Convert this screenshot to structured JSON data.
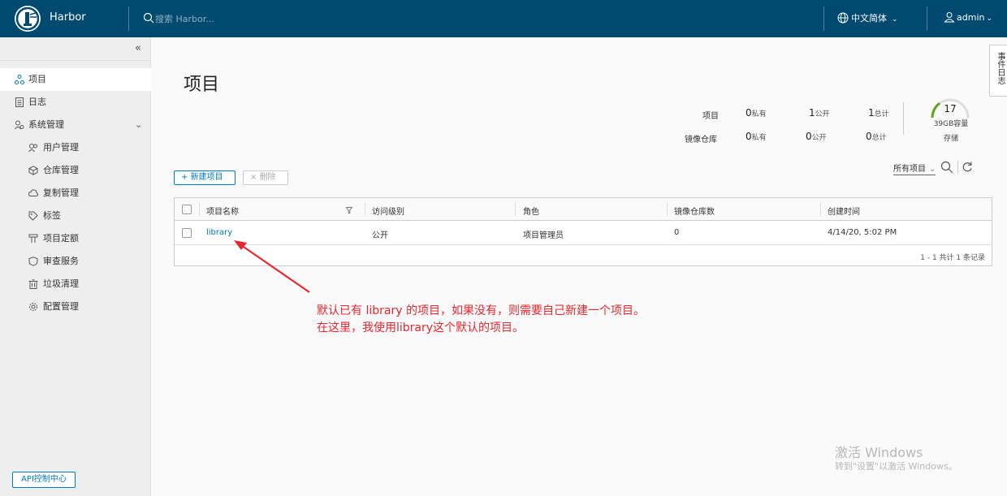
{
  "header": {
    "brand": "Harbor",
    "search_placeholder": "搜索 Harbor...",
    "language": "中文简体",
    "user": "admin"
  },
  "sidebar": {
    "items": [
      {
        "label": "项目",
        "icon": "projects-icon"
      },
      {
        "label": "日志",
        "icon": "logs-icon"
      },
      {
        "label": "系统管理",
        "icon": "admin-icon"
      },
      {
        "label": "用户管理",
        "icon": "users-icon"
      },
      {
        "label": "仓库管理",
        "icon": "registry-icon"
      },
      {
        "label": "复制管理",
        "icon": "replication-icon"
      },
      {
        "label": "标签",
        "icon": "tag-icon"
      },
      {
        "label": "项目定额",
        "icon": "quota-icon"
      },
      {
        "label": "审查服务",
        "icon": "shield-icon"
      },
      {
        "label": "垃圾清理",
        "icon": "trash-icon"
      },
      {
        "label": "配置管理",
        "icon": "gear-icon"
      }
    ],
    "api_button": "API控制中心"
  },
  "main": {
    "title": "项目",
    "stats": {
      "projects_label": "项目",
      "repos_label": "镜像仓库",
      "private_label": "私有",
      "public_label": "公开",
      "total_label": "总计",
      "projects_private": "0",
      "projects_public": "1",
      "projects_total": "1",
      "repos_private": "0",
      "repos_public": "0",
      "repos_total": "0"
    },
    "storage": {
      "count": "17",
      "capacity": "39GB容量",
      "label": "存储",
      "gauge_fraction": 0.3
    },
    "filter": "所有项目",
    "new_button": "+ 新建项目",
    "delete_button": "× 删除",
    "table": {
      "headers": [
        "项目名称",
        "访问级别",
        "角色",
        "镜像仓库数",
        "创建时间"
      ],
      "rows": [
        {
          "name": "library",
          "access": "公开",
          "role": "项目管理员",
          "repos": "0",
          "created": "4/14/20, 5:02 PM"
        }
      ],
      "footer": "1 - 1 共计 1 条记录"
    },
    "annotation_line1": "默认已有 library 的项目，如果没有，则需要自己新建一个项目。",
    "annotation_line2": "在这里，我使用library这个默认的项目。"
  },
  "event_tab": "事件日志",
  "watermark": {
    "line1": "激活 Windows",
    "line2": "转到\"设置\"以激活 Windows。"
  },
  "colors": {
    "header_bg": "#004a70",
    "link": "#0079b8",
    "annotation": "#e8262d",
    "gauge": "#62a420"
  }
}
